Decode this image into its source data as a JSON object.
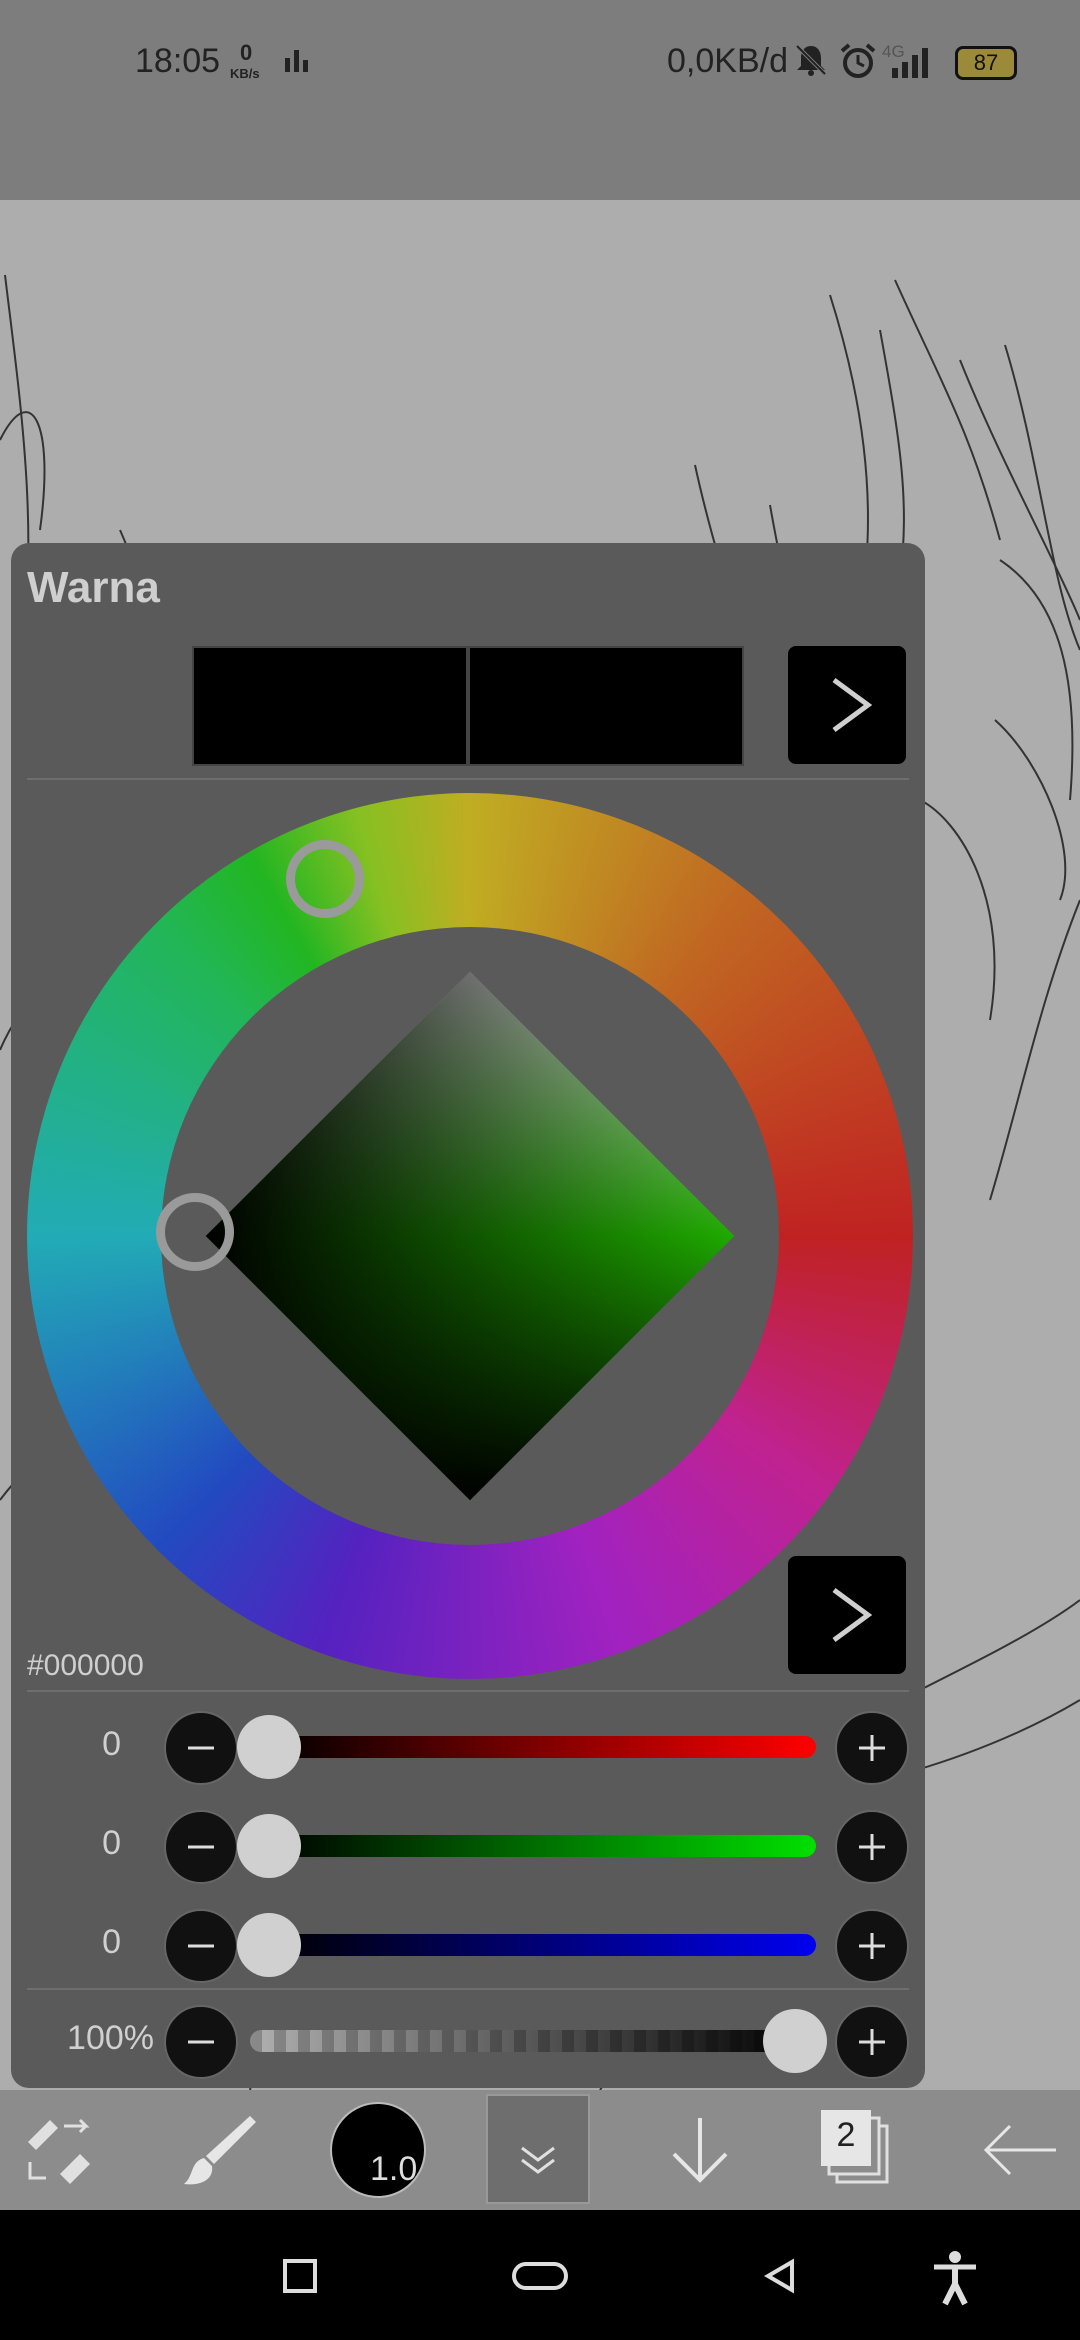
{
  "status_bar": {
    "time": "18:05",
    "net_speed_value": "0",
    "net_speed_unit": "KB/s",
    "data_usage": "0,0KB/d",
    "network": "4G",
    "battery": "87"
  },
  "color_panel": {
    "title": "Warna",
    "hex_value": "#000000",
    "red": {
      "value": "0"
    },
    "green": {
      "value": "0"
    },
    "blue": {
      "value": "0"
    },
    "opacity": {
      "value": "100%"
    },
    "colors": {
      "red": "#ff0000",
      "green": "#00d000",
      "blue": "#0000e0",
      "selected_hue": "#1faa00"
    }
  },
  "toolbar": {
    "brush_size": "1.0",
    "layer_count": "2"
  },
  "icons": {
    "swap": "swap-tools-icon",
    "brush": "brush-icon",
    "collapse": "chevron-double-down-icon",
    "download": "arrow-down-icon",
    "layers": "layers-icon",
    "back": "arrow-left-icon",
    "recents": "square-icon",
    "home": "pill-home-icon",
    "nav_back": "triangle-back-icon",
    "accessibility": "accessibility-icon"
  }
}
